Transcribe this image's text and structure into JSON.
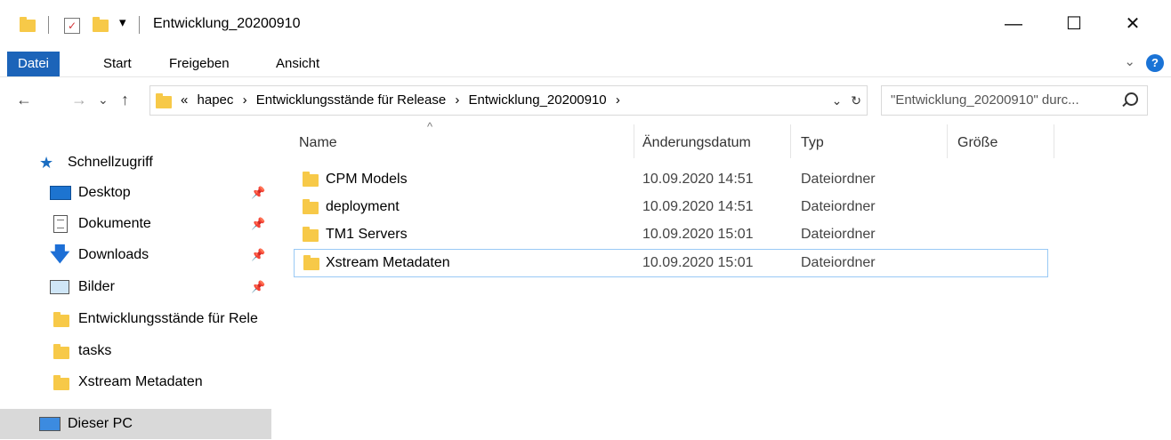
{
  "window": {
    "title": "Entwicklung_20200910",
    "quick_access_dropdown": "▾",
    "controls": {
      "minimize": "—",
      "maximize": "☐",
      "close": "✕"
    }
  },
  "ribbon": {
    "tabs": [
      {
        "label": "Datei",
        "active": true
      },
      {
        "label": "Start"
      },
      {
        "label": "Freigeben"
      },
      {
        "label": "Ansicht"
      }
    ],
    "collapse_chevron": "⌄",
    "help_label": "?"
  },
  "navigation": {
    "back": "←",
    "forward": "→",
    "recent": "⌄",
    "up": "↑"
  },
  "address": {
    "overflow": "«",
    "separator": "›",
    "crumbs": [
      "hapec",
      "Entwicklungsstände für Release",
      "Entwicklung_20200910"
    ],
    "dropdown": "⌄",
    "refresh": "↻"
  },
  "search": {
    "text": "\"Entwicklung_20200910\" durc..."
  },
  "nav_pane": {
    "quick_access": "Schnellzugriff",
    "items": [
      {
        "label": "Desktop",
        "pinned": true,
        "icon": "desktop-icon"
      },
      {
        "label": "Dokumente",
        "pinned": true,
        "icon": "documents-icon"
      },
      {
        "label": "Downloads",
        "pinned": true,
        "icon": "downloads-icon"
      },
      {
        "label": "Bilder",
        "pinned": true,
        "icon": "pictures-icon"
      },
      {
        "label": "Entwicklungsstände für Rele",
        "pinned": false,
        "icon": "folder-icon"
      },
      {
        "label": "tasks",
        "pinned": false,
        "icon": "folder-icon"
      },
      {
        "label": "Xstream Metadaten",
        "pinned": false,
        "icon": "folder-icon"
      }
    ],
    "this_pc": "Dieser PC",
    "pin_glyph": "📌"
  },
  "columns": {
    "sort_indicator": "^",
    "headers": [
      "Name",
      "Änderungsdatum",
      "Typ",
      "Größe"
    ]
  },
  "files": [
    {
      "name": "CPM Models",
      "date": "10.09.2020 14:51",
      "type": "Dateiordner"
    },
    {
      "name": "deployment",
      "date": "10.09.2020 14:51",
      "type": "Dateiordner"
    },
    {
      "name": "TM1 Servers",
      "date": "10.09.2020 15:01",
      "type": "Dateiordner"
    },
    {
      "name": "Xstream Metadaten",
      "date": "10.09.2020 15:01",
      "type": "Dateiordner"
    }
  ],
  "colors": {
    "accent": "#1c64b9",
    "folder": "#f7c948",
    "selection_border": "#99c9f5",
    "nav_selected": "#d9d9d9"
  }
}
